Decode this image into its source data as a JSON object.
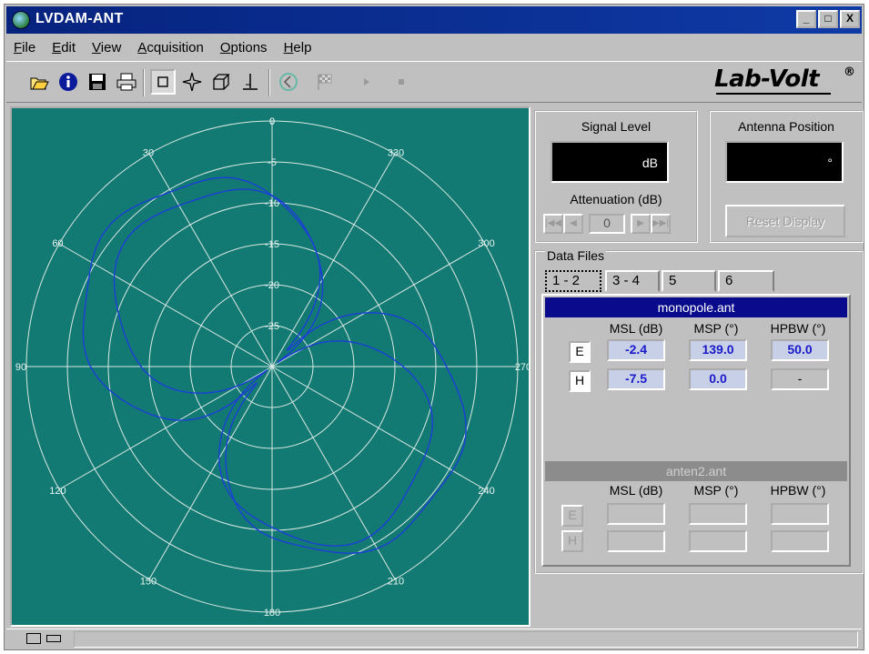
{
  "window": {
    "title": "LVDAM-ANT",
    "controls": [
      "_",
      "□",
      "X"
    ]
  },
  "menu": [
    "File",
    "Edit",
    "View",
    "Acquisition",
    "Options",
    "Help"
  ],
  "toolbar": {
    "icons": [
      "open-icon",
      "info-icon",
      "save-icon",
      "print-icon",
      "rectangle-tool-icon",
      "star-tool-icon",
      "cube-tool-icon",
      "perpendicular-icon",
      "rewind-icon",
      "checker-flag-icon",
      "play-icon",
      "stop-icon"
    ]
  },
  "logo": {
    "text": "Lab-Volt",
    "mark": "®"
  },
  "polar_plot": {
    "background": "#137a73",
    "ring_labels": [
      "0",
      "-5",
      "-10",
      "-15",
      "-20",
      "-25"
    ],
    "angle_labels": [
      "0",
      "30",
      "60",
      "90",
      "120",
      "150",
      "180",
      "210",
      "240",
      "270",
      "300",
      "330"
    ],
    "trace_color": "#1b3fd6"
  },
  "signal_level": {
    "title": "Signal Level",
    "unit": "dB",
    "attenuation_label": "Attenuation (dB)",
    "attenuation_value": "0",
    "nav_buttons": [
      "|◀◀",
      "◀",
      "▶",
      "▶▶|"
    ]
  },
  "antenna_position": {
    "title": "Antenna Position",
    "unit": "°",
    "reset_label": "Reset Display"
  },
  "data_files": {
    "title": "Data Files",
    "tabs": [
      "1 - 2",
      "3 - 4",
      "5",
      "6"
    ],
    "file1": {
      "name": "monopole.ant",
      "columns": [
        "MSL (dB)",
        "MSP (°)",
        "HPBW (°)"
      ],
      "rows": [
        {
          "label": "E",
          "values": [
            "-2.4",
            "139.0",
            "50.0"
          ]
        },
        {
          "label": "H",
          "values": [
            "-7.5",
            "0.0",
            "-"
          ]
        }
      ]
    },
    "file2": {
      "name": "anten2.ant",
      "columns": [
        "MSL (dB)",
        "MSP (°)",
        "HPBW (°)"
      ],
      "rows": [
        {
          "label": "E",
          "values": [
            "",
            "",
            ""
          ]
        },
        {
          "label": "H",
          "values": [
            "",
            "",
            ""
          ]
        }
      ]
    }
  }
}
